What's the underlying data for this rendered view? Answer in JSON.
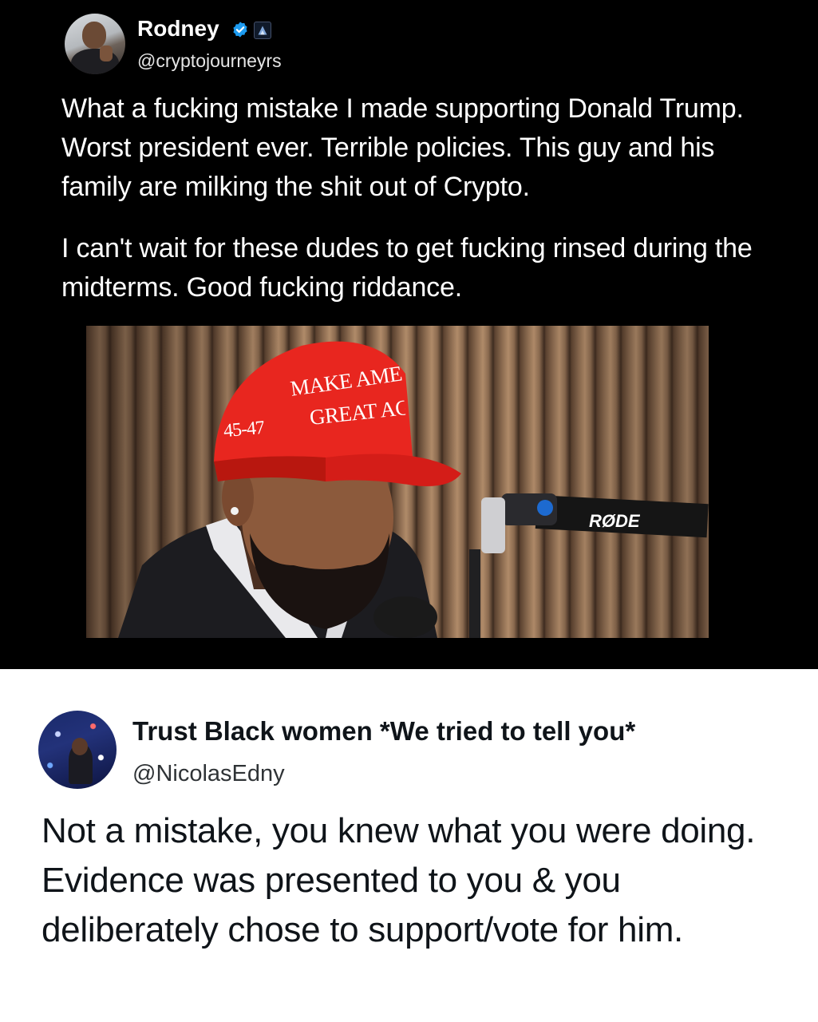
{
  "original_tweet": {
    "author_name": "Rodney",
    "author_handle": "@cryptojourneyrs",
    "verified_icon": "verified-check-icon",
    "paragraphs": [
      "What a fucking mistake I made supporting Donald Trump. Worst president ever. Terrible policies. This guy and his family are milking the shit out of Crypto.",
      "I can't wait for these dudes to get fucking rinsed during the midterms. Good fucking riddance."
    ],
    "photo": {
      "cap_line_1": "MAKE AMER",
      "cap_line_2": "GREAT AGA",
      "cap_number": "45-47",
      "mic_arm_label": "RØDE"
    },
    "colors": {
      "background": "#000000",
      "text": "#ffffff",
      "verified_badge": "#1d9bf0",
      "cap_red": "#e8261f"
    }
  },
  "reply_tweet": {
    "author_name": "Trust Black women *We tried to tell you*",
    "author_handle": "@NicolasEdny",
    "text": "Not a mistake, you knew what you were doing. Evidence was presented to you & you deliberately chose to support/vote for him.",
    "colors": {
      "background": "#ffffff",
      "text": "#0f1419"
    }
  }
}
